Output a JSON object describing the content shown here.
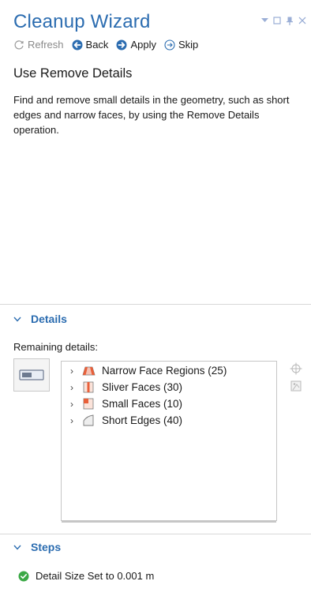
{
  "window": {
    "title": "Cleanup Wizard"
  },
  "toolbar": {
    "refresh_label": "Refresh",
    "back_label": "Back",
    "apply_label": "Apply",
    "skip_label": "Skip"
  },
  "main": {
    "heading": "Use Remove Details",
    "description": "Find and remove small details in the geometry, such as short edges and narrow faces, by using the Remove Details operation."
  },
  "details": {
    "section_title": "Details",
    "remaining_label": "Remaining details:",
    "items": [
      {
        "label": "Narrow Face Regions (25)",
        "icon": "narrow-face-icon"
      },
      {
        "label": "Sliver Faces (30)",
        "icon": "sliver-face-icon"
      },
      {
        "label": "Small Faces (10)",
        "icon": "small-face-icon"
      },
      {
        "label": "Short Edges (40)",
        "icon": "short-edge-icon"
      }
    ]
  },
  "steps": {
    "section_title": "Steps",
    "items": [
      {
        "label": "Detail Size Set to 0.001 m",
        "status": "done"
      }
    ]
  },
  "colors": {
    "accent": "#2b6cb0",
    "success": "#3aa845",
    "face_orange": "#e8603a"
  }
}
